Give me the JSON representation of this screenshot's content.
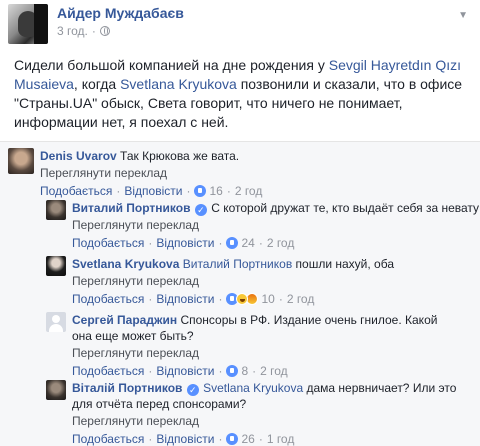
{
  "post": {
    "author": "Айдер Муждабаєв",
    "time": "3 год.",
    "text_pre": "Сидели большой компанией на дне рождения у ",
    "text_tag1": "Sevgil Hayretdın Qızı Musaieva",
    "text_mid": ", когда ",
    "text_tag2": "Svetlana Kryukova",
    "text_post": " позвонили и сказали, что в офисе \"Страны.UA\" обыск, Света говорит, что ничего не понимает, информации нет, я поехал с ней."
  },
  "ui": {
    "translate": "Переглянути переклад",
    "like": "Подобається",
    "reply": "Відповісти"
  },
  "comments": [
    {
      "name": "Denis Uvarov",
      "text": "Так Крюкова же вата.",
      "count": "16",
      "time": "2 год"
    },
    {
      "name": "Виталий Портников",
      "text": "С которой дружат те, кто выдаёт себя за невату",
      "count": "24",
      "time": "2 год"
    },
    {
      "name": "Svetlana Kryukova",
      "tag": "Виталий Портников",
      "text": "пошли нахуй, оба",
      "count": "10",
      "time": "2 год"
    },
    {
      "name": "Сергей Параджин",
      "text": "Спонсоры в РФ. Издание очень гнилое. Какой она еще может быть?",
      "count": "8",
      "time": "2 год"
    },
    {
      "name": "Віталій Портников",
      "tag": "Svetlana Kryukova",
      "text": "дама нервничает? Или это для отчёта перед спонсорами?",
      "count": "26",
      "time": "1 год"
    }
  ],
  "icons": {
    "privacy": "globe-icon",
    "menu": "chevron-down-icon",
    "reaction_like": "like-icon",
    "reaction_haha": "haha-icon",
    "reaction_angry": "angry-icon",
    "verified": "verified-icon"
  },
  "colors": {
    "link": "#365899",
    "meta": "#90949c",
    "like": "#5890ff"
  }
}
